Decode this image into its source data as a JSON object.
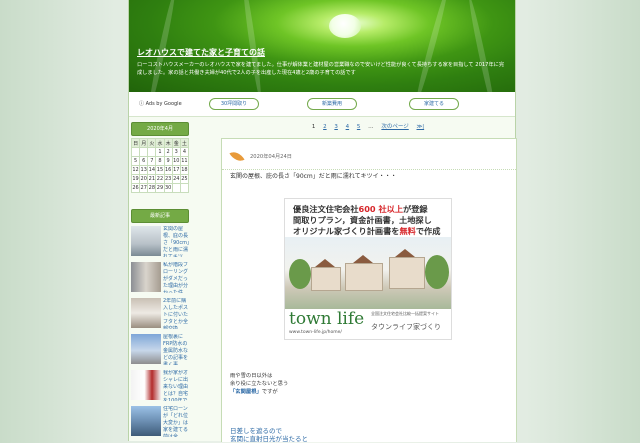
{
  "header": {
    "title": "レオハウスで建てた家と子育ての話",
    "description": "ローコストハウスメーカーのレオハウスで家を建てました。仕事が解体業と建材屋の営業職なので安いけど性能が良くて長持ちする家を目指して 2017年に完成しました。家の話と共働き夫婦が40代で2人の子を出産した現在4歳と2歳の子育ての話です"
  },
  "adbar": {
    "label": "ⓘ Ads by Google",
    "buttons": [
      "30坪間取り",
      "新築費用",
      "家建てる"
    ]
  },
  "pager": {
    "pages": [
      "1",
      "2",
      "3",
      "4",
      "5"
    ],
    "dots": "…",
    "next": "次のページ",
    "last": "≫|"
  },
  "calendar": {
    "title": "2020年4月",
    "headers": [
      "日",
      "月",
      "火",
      "水",
      "木",
      "金",
      "土"
    ],
    "rows": [
      [
        "",
        "",
        "",
        "1",
        "2",
        "3",
        "4"
      ],
      [
        "5",
        "6",
        "7",
        "8",
        "9",
        "10",
        "11"
      ],
      [
        "12",
        "13",
        "14",
        "15",
        "16",
        "17",
        "18"
      ],
      [
        "19",
        "20",
        "21",
        "22",
        "23",
        "24",
        "25"
      ],
      [
        "26",
        "27",
        "28",
        "29",
        "30",
        "",
        ""
      ]
    ]
  },
  "recent": {
    "title": "最新記事",
    "posts": [
      "玄関の屋根、庇の長さ「90cm」だと雨に濡れてキツイ・・・",
      "私が階段フローリングがダメだった理由が分かった件",
      "2年前に購入したポストに付いたフタとか全部交換",
      "屋根裏にFRP防水の金属防水などの記事を書く事",
      "我が家がオシャレに出来ない理由とは？自宅を100年で鍛えますと書いた方法",
      "住宅ローンが「どれ位大変か」は家を建てる前は全然・・・"
    ]
  },
  "article": {
    "date": "2020年04月24日",
    "title": "玄関の屋根、庇の長さ「90cm」だと雨に濡れてキツイ・・・",
    "body1": "雨や雪の日以外は",
    "body2": "余り役に立たないと思う",
    "keyword": "「玄関屋根」",
    "body3": "ですが",
    "body4": "日差しを遮るので",
    "body5": "玄関に直射日光が当たると"
  },
  "ad": {
    "line1a": "優良注文住宅会社",
    "line1b": "600 社以上",
    "line1c": "が登録",
    "line2": "間取りプラン，資金計画書，土地探し",
    "line3a": "オリジナル家づくり計画書を",
    "line3b": "無料",
    "line3c": "で作成",
    "brand": "town life",
    "brand_note": "全国注文住宅会社比較一括提案サイト",
    "brand_jp": "タウンライフ家づくり",
    "url": "www.town-life.jp/home/"
  }
}
